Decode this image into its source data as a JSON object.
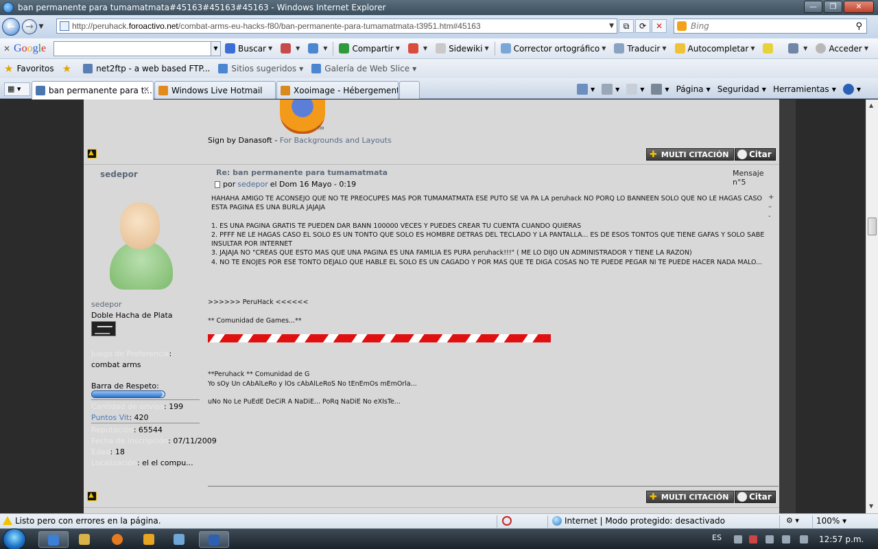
{
  "window": {
    "title": "ban permanente para tumamatmata#45163#45163#45163 - Windows Internet Explorer",
    "minimize": "—",
    "maximize": "❐",
    "close": "✕"
  },
  "address": {
    "url_prefix": "http://peruhack.",
    "url_domain": "foroactivo.net",
    "url_path": "/combat-arms-eu-hacks-f80/ban-permanente-para-tumamatmata-t3951.htm#45163",
    "search_placeholder": "Bing"
  },
  "google_toolbar": {
    "logo": [
      "G",
      "o",
      "o",
      "g",
      "l",
      "e"
    ],
    "buscar": "Buscar",
    "compartir": "Compartir",
    "sidewiki": "Sidewiki",
    "corrector": "Corrector ortográfico",
    "traducir": "Traducir",
    "autocompletar": "Autocompletar",
    "acceder": "Acceder"
  },
  "favorites": {
    "favoritos": "Favoritos",
    "items": [
      "net2ftp - a web based FTP...",
      "Sitios sugeridos",
      "Galería de Web Slice"
    ]
  },
  "tabs": [
    {
      "label": "ban permanente para t...",
      "active": true
    },
    {
      "label": "Windows Live Hotmail",
      "active": false
    },
    {
      "label": "Xooimage - Hébergement ...",
      "active": false
    }
  ],
  "command_bar": {
    "pagina": "Página",
    "seguridad": "Seguridad",
    "herramientas": "Herramientas"
  },
  "forum": {
    "signature_prev": {
      "sign_by": "Sign by Danasoft - ",
      "sign_link": "For Backgrounds and Layouts"
    },
    "buttons": {
      "multi": "MULTI CITACIÓN",
      "citar": "Citar"
    },
    "post": {
      "username": "sedepor",
      "title": "Re: ban permanente para tumamatmata",
      "number": "Mensaje n°5",
      "meta_por": "por",
      "meta_author": "sedepor",
      "meta_date": "el Dom 16 Mayo - 0:19",
      "paragraphs": [
        "HAHAHA AMIGO TE ACONSEJO QUE NO TE PREOCUPES MAS POR TUMAMATMATA ESE PUTO SE VA PA LA peruhack NO PORQ LO BANNEEN SOLO QUE NO LE HAGAS CASO ESTA PAGINA ES UNA BURLA JAJAJA",
        "1. ES UNA PAGINA GRATIS TE PUEDEN DAR BANN 100000 VECES Y PUEDES CREAR TU CUENTA CUANDO QUIERAS\n2. PFFF NE LE HAGAS CASO EL SOLO ES UN TONTO QUE SOLO ES HOMBRE DETRAS DEL TECLADO Y LA PANTALLA... ES DE ESOS TONTOS QUE TIENE GAFAS Y SOLO SABE INSULTAR POR INTERNET\n3. JAJAJA NO \"CREAS QUE ESTO MAS QUE UNA PAGINA ES UNA FAMILIA ES PURA peruhack!!!\" ( ME LO DIJO UN ADMINISTRADOR Y TIENE LA RAZON)\n4. NO TE ENOJES POR ESE TONTO DEJALO QUE HABLE EL SOLO ES UN CAGADO Y POR MAS QUE TE DIGA COSAS NO TE PUEDE PEGAR NI TE PUEDE HACER NADA MALO..."
      ],
      "pm_plus": "+",
      "pm_minus": "–",
      "pm_dot": "-"
    },
    "profile": {
      "name": "sedepor",
      "rank": "Doble Hacha de Plata",
      "pref_label": "Juego de Preferencia",
      "pref_value": ": combat arms",
      "respect_label": "Barra de Respeto:",
      "respect_fill_fraction": 0.97,
      "posts_label": "Cantidad de envíos",
      "posts_value": ": 199",
      "vit_label": "Puntos Vit",
      "vit_value": ": 420",
      "rep_label": "Reputación",
      "rep_value": ": 65544",
      "date_label": "Fecha de inscripción",
      "date_value": ": 07/11/2009",
      "age_label": "Edad",
      "age_value": ": 18",
      "loc_label": "Localización",
      "loc_value": ": el el compu..."
    },
    "signature": {
      "line1": ">>>>>> PeruHack <<<<<<",
      "line2": "** Comunidad de Games...**",
      "line3": "**Peruhack ** Comunidad de G",
      "line4": "Yo sOy Un cAbAlLeRo y lOs cAbAlLeRoS No tEnEmOs mEmOrla...",
      "line5": "uNo No Le PuEdE DeCiR A NaDiE... PoRq NaDiE No eXIsTe..."
    }
  },
  "statusbar": {
    "text": "Listo pero con errores en la página.",
    "zone": "Internet | Modo protegido: desactivado",
    "zoom": "100%"
  },
  "taskbar": {
    "lang": "ES",
    "clock": "12:57 p.m."
  }
}
